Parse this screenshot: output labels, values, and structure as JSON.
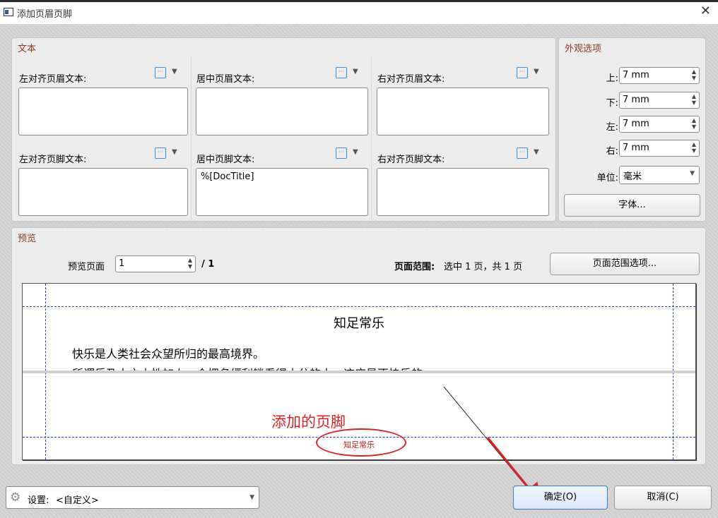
{
  "window": {
    "title": "添加页眉页脚",
    "close_glyph": "✕"
  },
  "text_panel": {
    "title": "文本",
    "header": {
      "left_label": "左对齐页眉文本:",
      "center_label": "居中页眉文本:",
      "right_label": "右对齐页眉文本:",
      "left_value": "",
      "center_value": "",
      "right_value": ""
    },
    "footer": {
      "left_label": "左对齐页脚文本:",
      "center_label": "居中页脚文本:",
      "right_label": "右对齐页脚文本:",
      "left_value": "",
      "center_value": "%[DocTitle]",
      "right_value": ""
    },
    "macro_icon_glyph": "[···]",
    "dropdown_glyph": "▼"
  },
  "appearance": {
    "title": "外观选项",
    "top_label": "上:",
    "top_value": "7 mm",
    "bottom_label": "下:",
    "bottom_value": "7 mm",
    "left_label": "左:",
    "left_value": "7 mm",
    "right_label": "右:",
    "right_value": "7 mm",
    "unit_label": "单位:",
    "unit_value": "毫米",
    "font_button": "字体..."
  },
  "preview": {
    "title": "预览",
    "page_label": "预览页面",
    "page_value": "1",
    "page_total": "/ 1",
    "range_label": "页面范围:",
    "range_text": "选中 1 页，共 1 页",
    "range_button": "页面范围选项...",
    "doc_title": "知足常乐",
    "doc_line1": "快乐是人类社会众望所归的最高境界。",
    "doc_line2": "所谓乐乃人之本性加上一个把名缰利锁看得十分的人，这应是不快乐的",
    "footer_text": "知足常乐"
  },
  "annotation": {
    "text": "添加的页脚",
    "color": "#e02020"
  },
  "bottom": {
    "settings_label": "设置:",
    "settings_value": "<自定义>",
    "ok_button": "确定(O)",
    "cancel_button": "取消(C)"
  },
  "icons": {
    "spin": "▲▼",
    "dropdown": "▼",
    "gear": "gear-icon"
  }
}
